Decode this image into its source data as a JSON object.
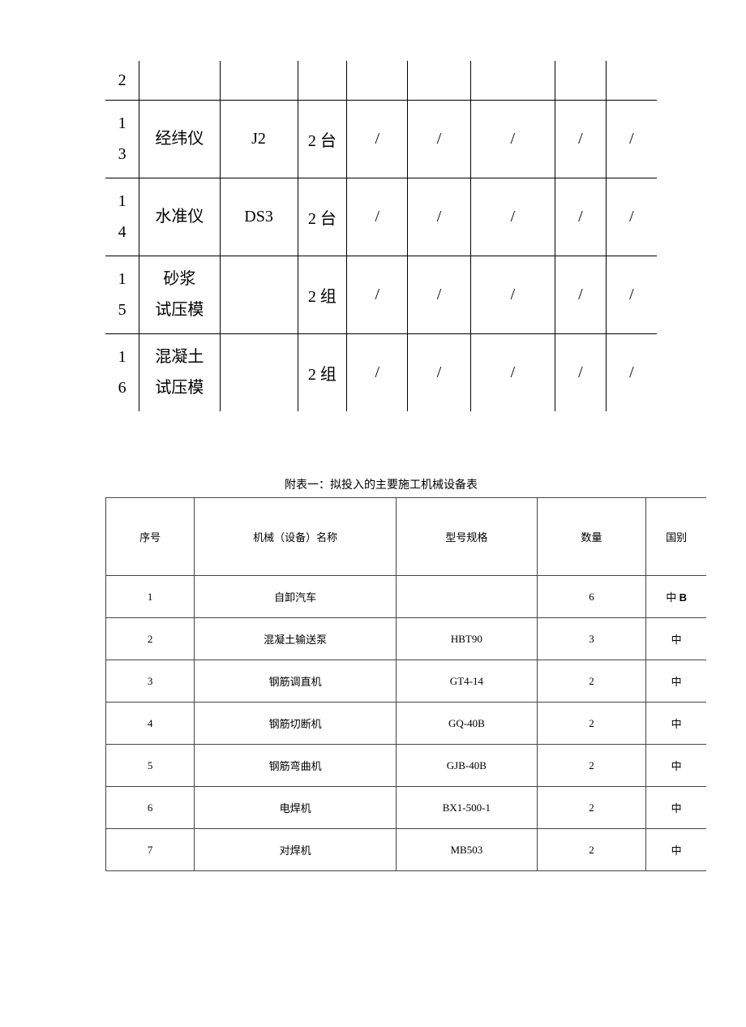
{
  "top_table": {
    "rows": [
      {
        "idx_lines": [
          "2"
        ],
        "name_lines": [
          ""
        ],
        "spec": "",
        "qty": "",
        "c4": "",
        "c5": "",
        "c6": "",
        "c7": "",
        "c8": ""
      },
      {
        "idx_lines": [
          "1",
          "3"
        ],
        "name_lines": [
          "经纬仪"
        ],
        "spec": "J2",
        "qty": "2 台",
        "c4": "/",
        "c5": "/",
        "c6": "/",
        "c7": "/",
        "c8": "/"
      },
      {
        "idx_lines": [
          "1",
          "4"
        ],
        "name_lines": [
          "水准仪"
        ],
        "spec": "DS3",
        "qty": "2 台",
        "c4": "/",
        "c5": "/",
        "c6": "/",
        "c7": "/",
        "c8": "/"
      },
      {
        "idx_lines": [
          "1",
          "5"
        ],
        "name_lines": [
          "砂浆",
          "试压模"
        ],
        "spec": "",
        "qty": "2 组",
        "c4": "/",
        "c5": "/",
        "c6": "/",
        "c7": "/",
        "c8": "/"
      },
      {
        "idx_lines": [
          "1",
          "6"
        ],
        "name_lines": [
          "混凝土",
          "试压模"
        ],
        "spec": "",
        "qty": "2 组",
        "c4": "/",
        "c5": "/",
        "c6": "/",
        "c7": "/",
        "c8": "/"
      }
    ]
  },
  "bottom_caption": "附表一：拟投入的主要施工机械设备表",
  "bottom_table": {
    "headers": [
      "序号",
      "机械（设备）名称",
      "型号规格",
      "数量",
      "国别"
    ],
    "rows": [
      {
        "idx": "1",
        "name": "自卸汽车",
        "spec": "",
        "qty": "6",
        "country": "中",
        "suffix_b": "B"
      },
      {
        "idx": "2",
        "name": "混凝土输送泵",
        "spec": "HBT90",
        "qty": "3",
        "country": "中"
      },
      {
        "idx": "3",
        "name": "钢筋调直机",
        "spec": "GT4-14",
        "qty": "2",
        "country": "中"
      },
      {
        "idx": "4",
        "name": "钢筋切断机",
        "spec": "GQ-40B",
        "qty": "2",
        "country": "中"
      },
      {
        "idx": "5",
        "name": "钢筋弯曲机",
        "spec": "GJB-40B",
        "qty": "2",
        "country": "中"
      },
      {
        "idx": "6",
        "name": "电焊机",
        "spec": "BX1-500-1",
        "qty": "2",
        "country": "中"
      },
      {
        "idx": "7",
        "name": "对焊机",
        "spec": "MB503",
        "qty": "2",
        "country": "中"
      }
    ]
  }
}
